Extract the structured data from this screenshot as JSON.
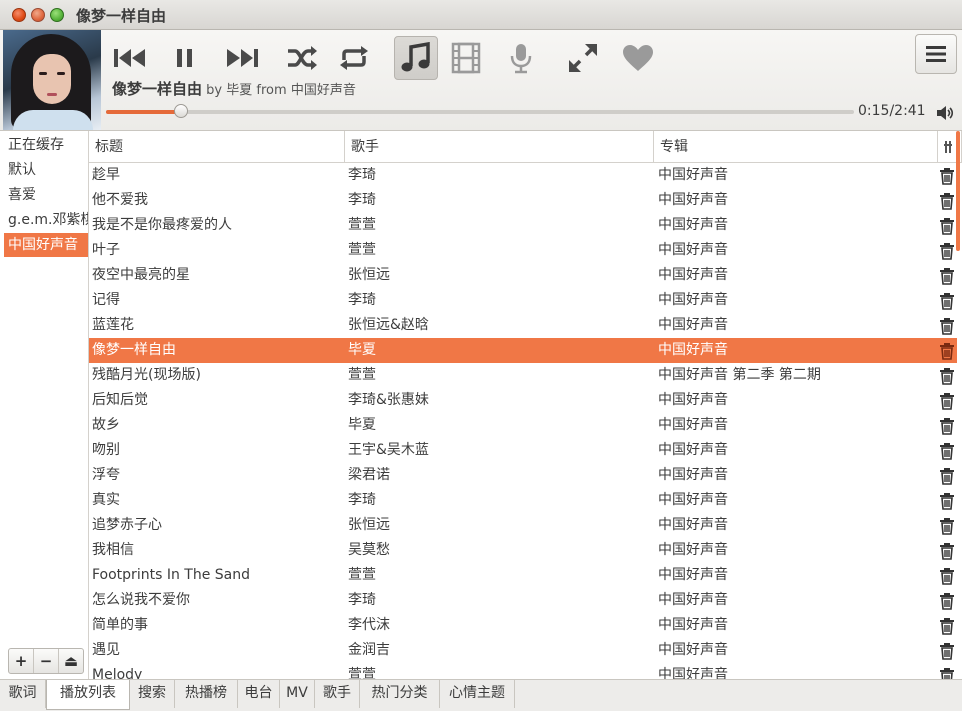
{
  "window": {
    "title": "像梦一样自由"
  },
  "now_playing": {
    "title": "像梦一样自由",
    "by_label": "by",
    "artist": "毕夏",
    "from_label": "from",
    "album": "中国好声音",
    "progress": 0.1,
    "time": "0:15/2:41"
  },
  "controls": {
    "prev": "previous-icon",
    "pause": "pause-icon",
    "next": "next-icon",
    "shuffle": "shuffle-icon",
    "repeat": "repeat-icon",
    "lyrics_mode": "music-note-icon",
    "mv_mode": "film-icon",
    "mic_mode": "microphone-icon",
    "fullscreen": "expand-icon",
    "favorite": "heart-icon",
    "menu": "menu-icon",
    "volume": "volume-icon"
  },
  "sidebar": {
    "items": [
      {
        "label": "正在缓存",
        "selected": false
      },
      {
        "label": "默认",
        "selected": false
      },
      {
        "label": "喜爱",
        "selected": false
      },
      {
        "label": "g.e.m.邓紫棋",
        "selected": false
      },
      {
        "label": "中国好声音",
        "selected": true
      }
    ],
    "tools": {
      "add": "+",
      "remove": "−",
      "eject": "⏏"
    }
  },
  "table": {
    "headers": {
      "title": "标题",
      "artist": "歌手",
      "album": "专辑"
    },
    "rows": [
      {
        "title": "趁早",
        "artist": "李琦",
        "album": "中国好声音"
      },
      {
        "title": "他不爱我",
        "artist": "李琦",
        "album": "中国好声音"
      },
      {
        "title": "我是不是你最疼爱的人",
        "artist": "萱萱",
        "album": "中国好声音"
      },
      {
        "title": "叶子",
        "artist": "萱萱",
        "album": "中国好声音"
      },
      {
        "title": "夜空中最亮的星",
        "artist": "张恒远",
        "album": "中国好声音"
      },
      {
        "title": "记得",
        "artist": "李琦",
        "album": "中国好声音"
      },
      {
        "title": "蓝莲花",
        "artist": "张恒远&赵晗",
        "album": "中国好声音"
      },
      {
        "title": "像梦一样自由",
        "artist": "毕夏",
        "album": "中国好声音",
        "selected": true
      },
      {
        "title": "残酷月光(现场版)",
        "artist": "萱萱",
        "album": "中国好声音 第二季 第二期"
      },
      {
        "title": "后知后觉",
        "artist": "李琦&张惠妹",
        "album": "中国好声音"
      },
      {
        "title": "故乡",
        "artist": "毕夏",
        "album": "中国好声音"
      },
      {
        "title": "吻别",
        "artist": "王宇&吴木蓝",
        "album": "中国好声音"
      },
      {
        "title": "浮夸",
        "artist": "梁君诺",
        "album": "中国好声音"
      },
      {
        "title": "真实",
        "artist": "李琦",
        "album": "中国好声音"
      },
      {
        "title": "追梦赤子心",
        "artist": "张恒远",
        "album": "中国好声音"
      },
      {
        "title": "我相信",
        "artist": "吴莫愁",
        "album": "中国好声音"
      },
      {
        "title": "Footprints In The Sand",
        "artist": "萱萱",
        "album": "中国好声音"
      },
      {
        "title": "怎么说我不爱你",
        "artist": "李琦",
        "album": "中国好声音"
      },
      {
        "title": "简单的事",
        "artist": "李代沫",
        "album": "中国好声音"
      },
      {
        "title": "遇见",
        "artist": "金润吉",
        "album": "中国好声音"
      },
      {
        "title": "Melody",
        "artist": "萱萱",
        "album": "中国好声音"
      }
    ]
  },
  "tabs": [
    {
      "label": "歌词",
      "active": false
    },
    {
      "label": "播放列表",
      "active": true
    },
    {
      "label": "搜索",
      "active": false
    },
    {
      "label": "热播榜",
      "active": false
    },
    {
      "label": "电台",
      "active": false
    },
    {
      "label": "MV",
      "active": false
    },
    {
      "label": "歌手",
      "active": false
    },
    {
      "label": "热门分类",
      "active": false
    },
    {
      "label": "心情主题",
      "active": false
    }
  ],
  "colors": {
    "accent": "#f07746",
    "progress": "#e56a3a"
  }
}
